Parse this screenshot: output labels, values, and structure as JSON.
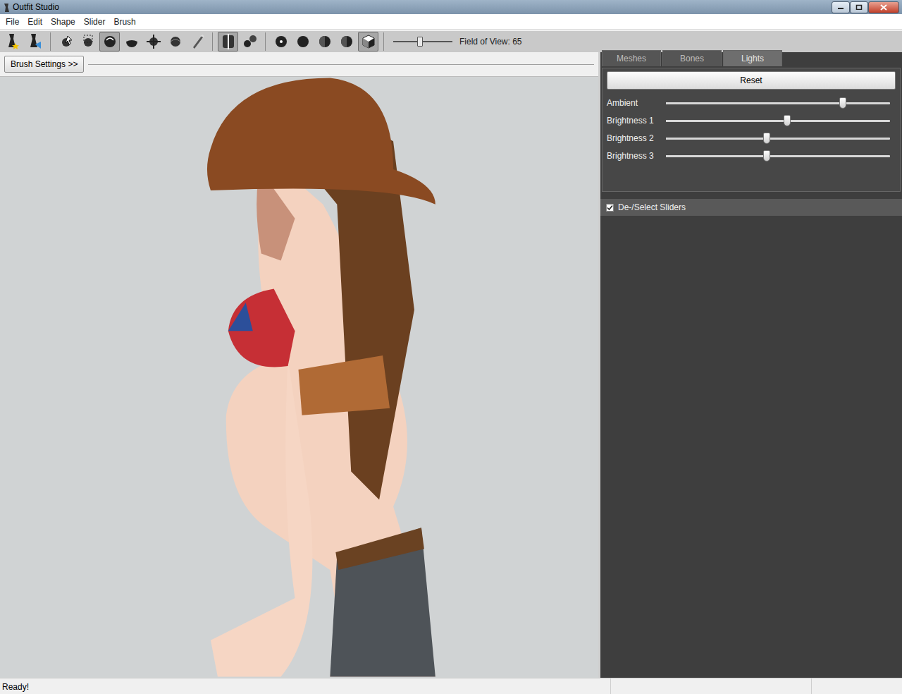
{
  "window": {
    "title": "Outfit Studio"
  },
  "menu": [
    "File",
    "Edit",
    "Shape",
    "Slider",
    "Brush"
  ],
  "toolbar": {
    "groups": [
      [
        {
          "kind": "project",
          "selected": false
        },
        {
          "kind": "reference",
          "selected": false
        }
      ],
      [
        {
          "kind": "select",
          "selected": false
        },
        {
          "kind": "mask",
          "selected": false
        },
        {
          "kind": "inflate",
          "selected": true
        },
        {
          "kind": "deflate",
          "selected": false
        },
        {
          "kind": "move",
          "selected": false
        },
        {
          "kind": "smooth",
          "selected": false
        },
        {
          "kind": "weight",
          "selected": false
        }
      ],
      [
        {
          "kind": "mirror",
          "selected": true
        },
        {
          "kind": "connected",
          "selected": false
        }
      ],
      [
        {
          "kind": "dot",
          "selected": false
        },
        {
          "kind": "circle",
          "selected": false
        },
        {
          "kind": "halfcircle",
          "selected": false
        },
        {
          "kind": "halfcircle",
          "selected": false
        },
        {
          "kind": "cube",
          "selected": true
        }
      ]
    ],
    "fov": {
      "label": "Field of View: 65",
      "level": 0.45
    }
  },
  "brush_settings": {
    "label": "Brush Settings >>"
  },
  "tabs": [
    {
      "label": "Meshes",
      "selected": false
    },
    {
      "label": "Bones",
      "selected": false
    },
    {
      "label": "Lights",
      "selected": true
    }
  ],
  "lights": {
    "reset": "Reset",
    "sliders": [
      {
        "name": "Ambient",
        "level": 0.79
      },
      {
        "name": "Brightness 1",
        "level": 0.54
      },
      {
        "name": "Brightness 2",
        "level": 0.45
      },
      {
        "name": "Brightness 3",
        "level": 0.45
      }
    ]
  },
  "slider_select": {
    "label": "De-/Select Sliders",
    "checked": true
  },
  "status_bar": {
    "text": "Ready!"
  }
}
